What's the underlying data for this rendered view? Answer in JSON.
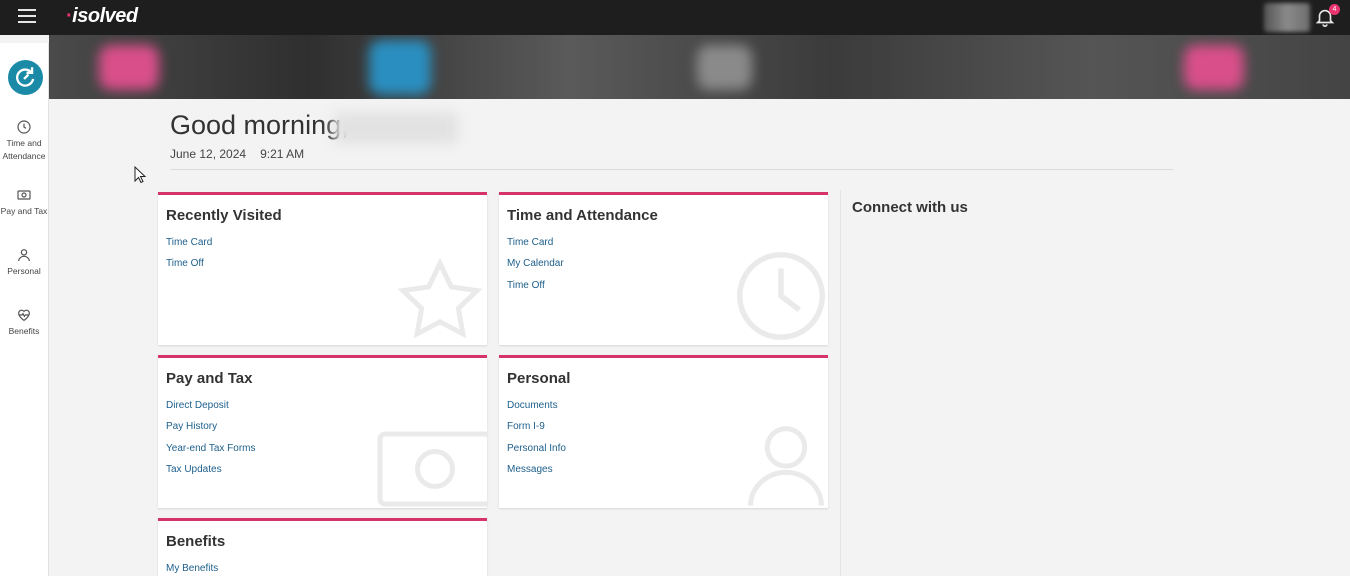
{
  "header": {
    "logo_text": "isolved",
    "notifications_count": "4"
  },
  "rail": {
    "items": [
      {
        "label": "Time and Attendance",
        "icon": "clock-icon"
      },
      {
        "label": "Pay and Tax",
        "icon": "money-icon"
      },
      {
        "label": "Personal",
        "icon": "person-icon"
      },
      {
        "label": "Benefits",
        "icon": "heart-pulse-icon"
      }
    ]
  },
  "greeting": {
    "text": "Good morning,",
    "date": "June 12, 2024",
    "time": "9:21 AM"
  },
  "cards": [
    {
      "title": "Recently Visited",
      "links": [
        "Time Card",
        "Time Off"
      ],
      "bg_icon": "star-icon"
    },
    {
      "title": "Time and Attendance",
      "links": [
        "Time Card",
        "My Calendar",
        "Time Off"
      ],
      "bg_icon": "clock-icon"
    },
    {
      "title": "Pay and Tax",
      "links": [
        "Direct Deposit",
        "Pay History",
        "Year-end Tax Forms",
        "Tax Updates"
      ],
      "bg_icon": "money-icon"
    },
    {
      "title": "Personal",
      "links": [
        "Documents",
        "Form I-9",
        "Personal Info",
        "Messages"
      ],
      "bg_icon": "person-icon"
    },
    {
      "title": "Benefits",
      "links": [
        "My Benefits"
      ],
      "bg_icon": ""
    }
  ],
  "connect": {
    "title": "Connect with us"
  },
  "colors": {
    "accent": "#d6336c",
    "link": "#1d5f8c",
    "rail_button": "#1a8aa6",
    "topbar": "#1e1e1e"
  }
}
